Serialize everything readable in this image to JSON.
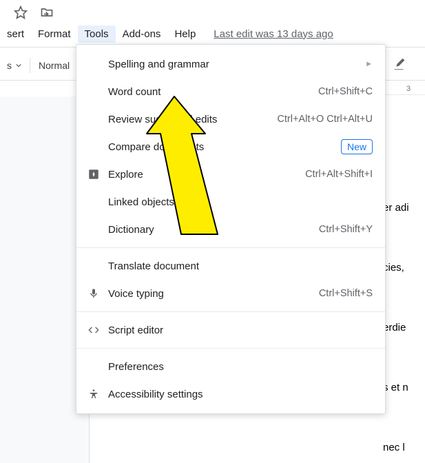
{
  "menubar": {
    "items": [
      "sert",
      "Format",
      "Tools",
      "Add-ons",
      "Help"
    ],
    "active_index": 2,
    "last_edit": "Last edit was 13 days ago"
  },
  "toolbar": {
    "zoom_suffix": "s",
    "style": "Normal"
  },
  "ruler": {
    "marks": [
      "3"
    ]
  },
  "dropdown": {
    "items": [
      {
        "label": "Spelling and grammar",
        "shortcut": "",
        "arrow": true
      },
      {
        "label": "Word count",
        "shortcut": "Ctrl+Shift+C"
      },
      {
        "label": "Review suggested edits",
        "shortcut": "Ctrl+Alt+O Ctrl+Alt+U"
      },
      {
        "label": "Compare documents",
        "new_badge": "New"
      },
      {
        "label": "Explore",
        "shortcut": "Ctrl+Alt+Shift+I",
        "icon": "explore"
      },
      {
        "label": "Linked objects"
      },
      {
        "label": "Dictionary",
        "shortcut": "Ctrl+Shift+Y"
      },
      {
        "divider": true
      },
      {
        "label": "Translate document"
      },
      {
        "label": "Voice typing",
        "shortcut": "Ctrl+Shift+S",
        "icon": "mic"
      },
      {
        "divider": true
      },
      {
        "label": "Script editor",
        "icon": "code"
      },
      {
        "divider": true
      },
      {
        "label": "Preferences"
      },
      {
        "label": "Accessibility settings",
        "icon": "accessibility"
      }
    ]
  },
  "doc_text": "er adi\n\ncies,\n\nerdie\n\ns et n\n\nnec l"
}
